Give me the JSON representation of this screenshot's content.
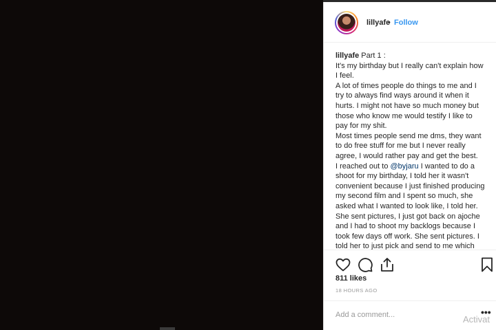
{
  "header": {
    "username": "lillyafe",
    "separator": "•",
    "follow_label": "Follow"
  },
  "caption": {
    "username": "lillyafe",
    "text_before_mention": " Part 1 :\nIt's my birthday but I really can't explain how I feel.\nA lot of times people do things to me and I try to always find ways around it when it hurts. I might not have so much money but those who know me would testify I like to pay for my shit.\nMost times people send me dms, they want to do free stuff for me but I never really agree, I would rather pay and get the best.\nI reached out to ",
    "mention": "@byjaru",
    "text_after_mention": " I wanted to do a shoot for my birthday, I told her it wasn't convenient because I just finished producing my second film and I spent so much, she asked what I wanted to look like, I told her. She sent pictures, I just got back on ajoche and I had to shoot my backlogs because I took few days off work. She sent pictures. I told her to just pick and send to me which she did. She asked if I could"
  },
  "actions": {
    "like_icon": "heart-icon",
    "comment_icon": "comment-icon",
    "share_icon": "share-icon",
    "save_icon": "bookmark-icon"
  },
  "likes": "811 likes",
  "timestamp": "18 HOURS AGO",
  "comment": {
    "placeholder": "Add a comment...",
    "more_label": "•••"
  },
  "watermark": "Activat",
  "colors": {
    "link": "#3897f0",
    "mention": "#003569",
    "text": "#262626",
    "muted": "#999999",
    "media_bg": "#0d0908"
  }
}
